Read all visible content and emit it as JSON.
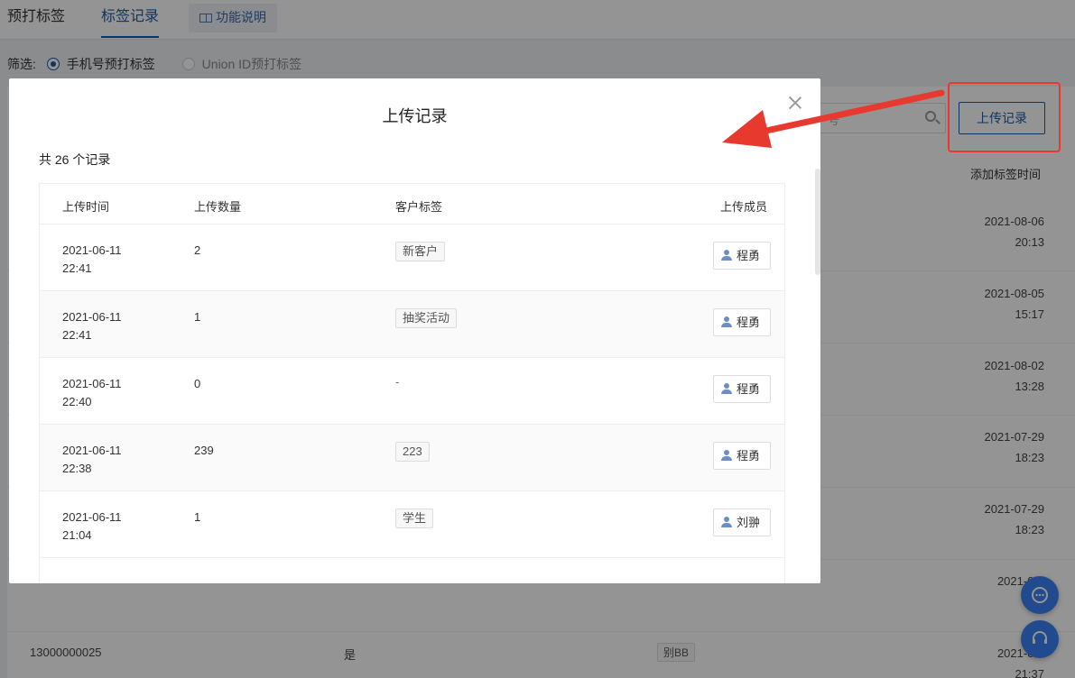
{
  "tabs": [
    {
      "label": "预打标签"
    },
    {
      "label": "标签记录"
    },
    {
      "label": "功能说明"
    }
  ],
  "filter": {
    "label": "筛选:",
    "options": [
      {
        "label": "手机号预打标签",
        "selected": true
      },
      {
        "label": "Union ID预打标签",
        "selected": false
      }
    ]
  },
  "toolbar": {
    "search_placeholder": "号",
    "upload_button": "上传记录"
  },
  "background_table": {
    "time_header": "添加标签时间",
    "times": [
      [
        "2021-08-06",
        "20:13"
      ],
      [
        "2021-08-05",
        "15:17"
      ],
      [
        "2021-08-02",
        "13:28"
      ],
      [
        "2021-07-29",
        "18:23"
      ],
      [
        "2021-07-29",
        "18:23"
      ],
      [
        "2021-07-",
        "1"
      ],
      [
        "2021-07-",
        "21:37"
      ]
    ],
    "last_row": {
      "phone": "13000000025",
      "flag": "是",
      "tag": "别BB"
    }
  },
  "modal": {
    "title": "上传记录",
    "count_text": "共 26 个记录",
    "columns": [
      "上传时间",
      "上传数量",
      "客户标签",
      "上传成员"
    ],
    "rows": [
      {
        "date": "2021-06-11",
        "time": "22:41",
        "quantity": "2",
        "tag": "新客户",
        "member": "程勇"
      },
      {
        "date": "2021-06-11",
        "time": "22:41",
        "quantity": "1",
        "tag": "抽奖活动",
        "member": "程勇"
      },
      {
        "date": "2021-06-11",
        "time": "22:40",
        "quantity": "0",
        "tag": "-",
        "member": "程勇"
      },
      {
        "date": "2021-06-11",
        "time": "22:38",
        "quantity": "239",
        "tag": "223",
        "member": "程勇"
      },
      {
        "date": "2021-06-11",
        "time": "21:04",
        "quantity": "1",
        "tag": "学生",
        "member": "刘翀"
      }
    ]
  },
  "colors": {
    "accent": "#1e5aa8",
    "annotation": "#e8392e",
    "fab": "#3b82f6"
  }
}
